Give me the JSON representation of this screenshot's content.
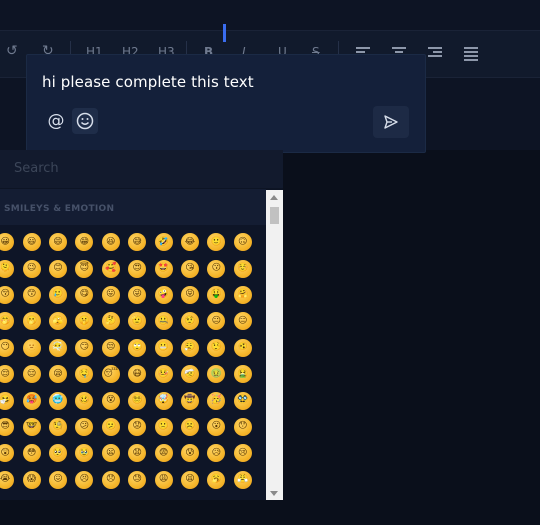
{
  "toolbar": {
    "undo_icon": "undo-icon",
    "redo_icon": "redo-icon",
    "heading_labels": [
      "H1",
      "H2",
      "H3"
    ],
    "format_labels": [
      "B",
      "I",
      "U",
      "S"
    ],
    "align_icons": [
      "align-left-icon",
      "align-center-icon",
      "align-right-icon",
      "align-justify-icon"
    ]
  },
  "comment": {
    "text": "hi please complete this text",
    "mention_icon": "at-icon",
    "emoji_icon": "smiley-icon",
    "send_icon": "send-icon"
  },
  "emoji_picker": {
    "search_placeholder": "Search",
    "category_label": "SMILEYS & EMOTION",
    "emojis": [
      "😀",
      "😃",
      "😄",
      "😁",
      "😆",
      "😅",
      "🤣",
      "😂",
      "🙂",
      "🙃",
      "🫠",
      "😉",
      "😊",
      "😇",
      "🥰",
      "😍",
      "🤩",
      "😘",
      "😗",
      "☺️",
      "😚",
      "😙",
      "🥲",
      "😋",
      "😛",
      "😜",
      "🤪",
      "😝",
      "🤑",
      "🤗",
      "🤭",
      "🫢",
      "🫣",
      "🤫",
      "🤔",
      "🫡",
      "🤐",
      "🤨",
      "😐",
      "😑",
      "😶",
      "🫥",
      "😶‍🌫️",
      "😏",
      "😒",
      "🙄",
      "😬",
      "😮‍💨",
      "🤥",
      "🫨",
      "😌",
      "😔",
      "😪",
      "🤤",
      "😴",
      "😷",
      "🤒",
      "🤕",
      "🤢",
      "🤮",
      "🤧",
      "🥵",
      "🥶",
      "🥴",
      "😵",
      "😵‍💫",
      "🤯",
      "🤠",
      "🥳",
      "🥸",
      "😎",
      "🤓",
      "🧐",
      "😕",
      "🫤",
      "😟",
      "🙁",
      "☹️",
      "😮",
      "😯",
      "😲",
      "😳",
      "🥺",
      "🥹",
      "😦",
      "😧",
      "😨",
      "😰",
      "😥",
      "😢",
      "😭",
      "😱",
      "😖",
      "😣",
      "😞",
      "😓",
      "😩",
      "😫",
      "🥱",
      "😤"
    ]
  }
}
